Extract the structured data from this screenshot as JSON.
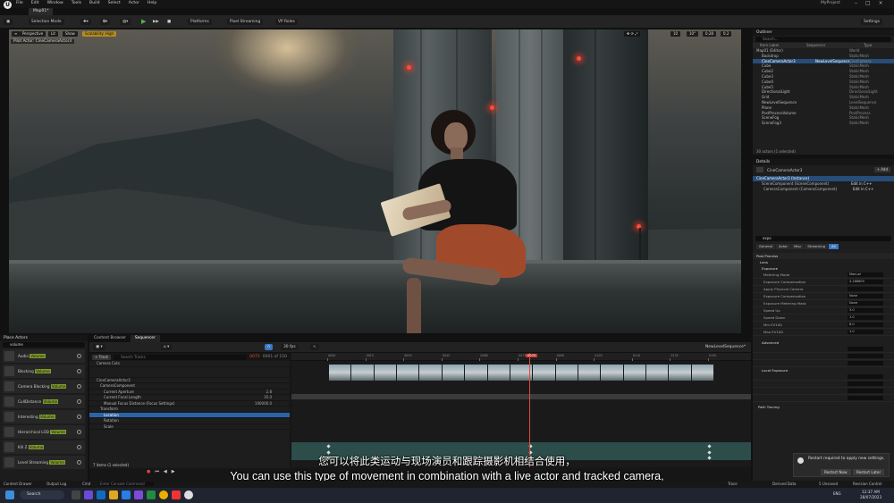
{
  "app": {
    "title": "MyProject",
    "map_tab": "Map01*",
    "menu": [
      "File",
      "Edit",
      "Window",
      "Tools",
      "Build",
      "Select",
      "Actor",
      "Help"
    ]
  },
  "toolbar": {
    "selection_mode": "Selection Mode",
    "platforms": "Platforms",
    "pixel_streaming": "Pixel Streaming",
    "vp_roles": "VP Roles",
    "settings": "Settings"
  },
  "viewport": {
    "perspective": "Perspective",
    "lit": "Lit",
    "show": "Show",
    "scalability": "Scalability: High",
    "pilot": "Pilot Actor: CineCameraActor3",
    "speed": "0.28",
    "fov": "0.2",
    "grid": "10",
    "angle": "10°"
  },
  "outliner": {
    "title": "Outliner",
    "search_placeholder": "Search...",
    "col_label": "Item Label",
    "col_sequencer": "Sequencer",
    "col_type": "Type",
    "rows": [
      {
        "label": "Map01 (Editor)",
        "seq": "",
        "type": "World",
        "sel": false
      },
      {
        "label": "Backdrop",
        "seq": "",
        "type": "StaticMesh",
        "sel": false
      },
      {
        "label": "CineCameraActor3",
        "seq": "NewLevelSequence",
        "type": "CineCamera",
        "sel": true
      },
      {
        "label": "Cube",
        "seq": "",
        "type": "StaticMesh",
        "sel": false
      },
      {
        "label": "Cube2",
        "seq": "",
        "type": "StaticMesh",
        "sel": false
      },
      {
        "label": "Cube3",
        "seq": "",
        "type": "StaticMesh",
        "sel": false
      },
      {
        "label": "Cube4",
        "seq": "",
        "type": "StaticMesh",
        "sel": false
      },
      {
        "label": "Cube5",
        "seq": "",
        "type": "StaticMesh",
        "sel": false
      },
      {
        "label": "DirectionalLight",
        "seq": "",
        "type": "DirectionalLight",
        "sel": false
      },
      {
        "label": "Grid",
        "seq": "",
        "type": "StaticMesh",
        "sel": false
      },
      {
        "label": "NewLevelSequence",
        "seq": "",
        "type": "LevelSequence",
        "sel": false
      },
      {
        "label": "Plane",
        "seq": "",
        "type": "StaticMesh",
        "sel": false
      },
      {
        "label": "PostProcessVolume",
        "seq": "",
        "type": "PostProcess",
        "sel": false
      },
      {
        "label": "SceneFog",
        "seq": "",
        "type": "StaticMesh",
        "sel": false
      },
      {
        "label": "SceneFog3",
        "seq": "",
        "type": "StaticMesh",
        "sel": false
      }
    ],
    "footer": "30 actors (1 selected)"
  },
  "details": {
    "title": "Details",
    "object": "CineCameraActor3",
    "add": "+ Add",
    "components": [
      {
        "label": "CineCameraActor3 (Instance)",
        "edit": ""
      },
      {
        "label": "SceneComponent (SceneComponent)",
        "edit": "Edit in C++"
      },
      {
        "label": "CameraComponent (CameraComponent)",
        "edit": "Edit in C++"
      }
    ],
    "search_value": "expo",
    "tabs": [
      "General",
      "Actor",
      "Misc",
      "Streaming",
      "All"
    ],
    "section_post": "Post Process",
    "section_lens": "Lens",
    "section_exposure": "Exposure",
    "props": [
      {
        "label": "Metering Mode",
        "value": "Manual"
      },
      {
        "label": "Exposure Compensation",
        "value": "4.166609"
      },
      {
        "label": "Apply Physical Camera",
        "value": ""
      },
      {
        "label": "Exposure Compensation",
        "value": "None"
      },
      {
        "label": "Exposure Metering Mask",
        "value": "None"
      },
      {
        "label": "Speed Up",
        "value": "3.0"
      },
      {
        "label": "Speed Down",
        "value": "1.0"
      },
      {
        "label": "Min EV100",
        "value": "8.0"
      },
      {
        "label": "Max EV100",
        "value": "1.0"
      }
    ],
    "section_advanced": "Advanced",
    "section_local": "Local Exposure",
    "section_pathtracing": "Path Tracing"
  },
  "place_actors": {
    "title": "Place Actors",
    "search_value": "volume",
    "items": [
      {
        "name": "Audio ",
        "hl": "Volume"
      },
      {
        "name": "Blocking ",
        "hl": "Volume"
      },
      {
        "name": "Camera Blocking ",
        "hl": "Volume"
      },
      {
        "name": "CullDistance ",
        "hl": "Volume"
      },
      {
        "name": "Interesting ",
        "hl": "Volume"
      },
      {
        "name": "Hierarchical LOD ",
        "hl": "Volume"
      },
      {
        "name": "Kill Z ",
        "hl": "Volume"
      },
      {
        "name": "Level Streaming ",
        "hl": "Volume"
      }
    ]
  },
  "sequencer": {
    "tab_content": "Content Browser",
    "tab_seq": "Sequencer",
    "track_btn": "+ Track",
    "search_placeholder": "Search Tracks",
    "fps": "30 fps",
    "frame": "0075",
    "range": "0001 of 150",
    "sequence_name": "NewLevelSequence*",
    "tracks": [
      {
        "label": "Camera Cuts",
        "sel": false
      },
      {
        "label": "",
        "sel": false
      },
      {
        "label": "CineCameraActor3",
        "sel": false
      },
      {
        "label": "CameraComponent",
        "sel": false
      },
      {
        "label": "Current Aperture",
        "sel": false
      },
      {
        "label": "Current Focal Length",
        "sel": false
      },
      {
        "label": "Manual Focus Distance (Focus Settings)",
        "sel": false
      },
      {
        "label": "Transform",
        "sel": false
      },
      {
        "label": "Location",
        "sel": true
      },
      {
        "label": "Rotation",
        "sel": false
      },
      {
        "label": "Scale",
        "sel": false
      }
    ],
    "aperture": "2.8",
    "focal": "35.0",
    "focus": "100000.0",
    "items_footer": "7 items (1 selected)",
    "ruler": [
      "0000",
      "0015",
      "0030",
      "0045",
      "0060",
      "0075",
      "0090",
      "0105",
      "0120",
      "0135",
      "0150"
    ]
  },
  "subtitles": {
    "zh": "您可以将此类运动与现场演员和跟踪摄影机相结合使用，",
    "en": "You can use this type of movement in combination with a live actor and tracked camera,"
  },
  "statusbar": {
    "content_drawer": "Content Drawer",
    "output_log": "Output Log",
    "cmd": "Cmd",
    "console": "Enter Console Command",
    "trace": "Trace",
    "derived": "Derived Data",
    "unsaved": "5 Unsaved",
    "revision": "Revision Control"
  },
  "taskbar": {
    "search": "Search",
    "time": "12:37 AM",
    "date": "28/07/2023",
    "lang": "ENG"
  },
  "toast": {
    "text": "Restart required to apply new settings.",
    "restart_now": "Restart Now",
    "restart_later": "Restart Later"
  }
}
